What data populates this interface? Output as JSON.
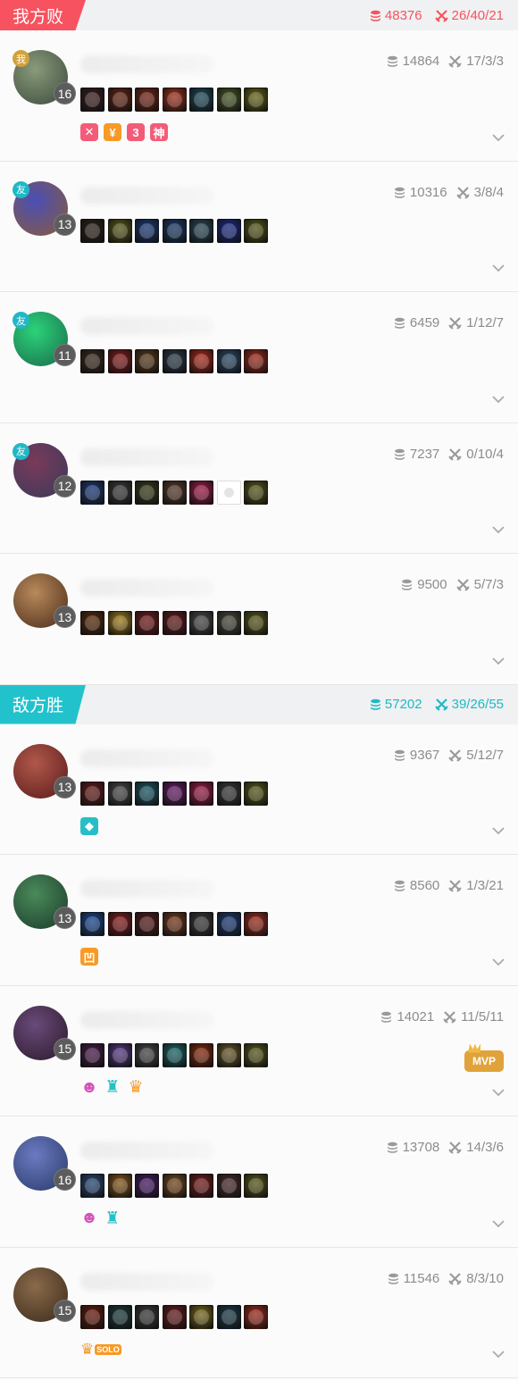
{
  "colors": {
    "lose": "#f7525f",
    "win": "#22c2cc",
    "badge_friend": "#1fb8c6",
    "badge_me": "#d2a23a",
    "badge_orange": "#f79a26",
    "badge_pink": "#f35c78",
    "badge_teal": "#26bfc8",
    "badge_purple": "#d255b9"
  },
  "team_lose": {
    "label": "我方败",
    "gold": "48376",
    "kda": "26/40/21",
    "players": [
      {
        "relation": "我",
        "level": "16",
        "gold": "14864",
        "kda": "17/3/3",
        "avatar": [
          "#3a4a3c",
          "#8a9a7a"
        ],
        "items": [
          "#3b1c1c",
          "#6a2412",
          "#7a2418",
          "#a5321a",
          "#1b4c5a",
          "#4a5a26",
          "#6a6a1a"
        ],
        "badges": [
          {
            "text": "✕",
            "color": "#f35c78"
          },
          {
            "text": "¥",
            "color": "#f79a26"
          },
          {
            "text": "3",
            "color": "#f35c78"
          },
          {
            "text": "神",
            "color": "#f35c78"
          }
        ]
      },
      {
        "relation": "友",
        "level": "13",
        "gold": "10316",
        "kda": "3/8/4",
        "avatar": [
          "#8a5a3a",
          "#4a4fb6"
        ],
        "items": [
          "#2a2016",
          "#5a5a1a",
          "#1a3a7a",
          "#1a3a6a",
          "#2a4a5a",
          "#1a2a8a",
          "#5a5a1a"
        ],
        "badges": []
      },
      {
        "relation": "友",
        "level": "11",
        "gold": "6459",
        "kda": "1/12/7",
        "avatar": [
          "#1a6a4a",
          "#2bd37a"
        ],
        "items": [
          "#3a2a1a",
          "#8a1a1a",
          "#5a3a1a",
          "#2a3a4a",
          "#b32a1a",
          "#2a4a6a",
          "#a52a1a"
        ],
        "badges": []
      },
      {
        "relation": "友",
        "level": "12",
        "gold": "7237",
        "kda": "0/10/4",
        "avatar": [
          "#3a3a5a",
          "#7a3a5a"
        ],
        "items": [
          "#1a3a7a",
          "#3a3a3a",
          "#3a3a1a",
          "#5a3a2a",
          "#a51a4a",
          "empty",
          "#5a5a1a"
        ],
        "badges": []
      },
      {
        "relation": "",
        "level": "13",
        "gold": "9500",
        "kda": "5/7/3",
        "avatar": [
          "#4a2a1a",
          "#b88a5a"
        ],
        "items": [
          "#5a2a0a",
          "#a5801a",
          "#7a1a1a",
          "#6a1a1a",
          "#4a4a4a",
          "#4a4a3a",
          "#5a5a1a"
        ],
        "badges": []
      }
    ]
  },
  "team_win": {
    "label": "敌方胜",
    "gold": "57202",
    "kda": "39/26/55",
    "players": [
      {
        "relation": "",
        "level": "13",
        "gold": "9367",
        "kda": "5/12/7",
        "avatar": [
          "#5a1a1a",
          "#b0584a"
        ],
        "items": [
          "#6a1a1a",
          "#4a4a4a",
          "#1a5a6a",
          "#6a1a6a",
          "#a51a4a",
          "#3a3a3a",
          "#5a5a1a"
        ],
        "badges": [
          {
            "text": "◆",
            "color": "#26bfc8"
          }
        ]
      },
      {
        "relation": "",
        "level": "13",
        "gold": "8560",
        "kda": "1/3/21",
        "avatar": [
          "#1a3a2a",
          "#4a8a5a"
        ],
        "items": [
          "#1a4a9a",
          "#8a1a1a",
          "#5a1a1a",
          "#7a3a1a",
          "#3a3a3a",
          "#1a3a7a",
          "#a52a1a"
        ],
        "badges": [
          {
            "text": "凹",
            "color": "#f79a26"
          }
        ]
      },
      {
        "relation": "",
        "level": "15",
        "gold": "14021",
        "kda": "11/5/11",
        "avatar": [
          "#2a1a2a",
          "#6a4a7a"
        ],
        "items": [
          "#4a1a4a",
          "#5a3a8a",
          "#4a4a4a",
          "#1a6a6a",
          "#8a2a0a",
          "#6a5a2a",
          "#5a5a1a"
        ],
        "badges": [
          {
            "text": "☻",
            "color": "#d255b9",
            "sym": true
          },
          {
            "text": "♜",
            "color": "#26bfc8",
            "sym": true
          },
          {
            "text": "♛",
            "color": "#f79a26",
            "sym": true
          }
        ],
        "mvp": "MVP"
      },
      {
        "relation": "",
        "level": "16",
        "gold": "13708",
        "kda": "14/3/6",
        "avatar": [
          "#2a3a6a",
          "#6a7ac0"
        ],
        "items": [
          "#2a4a7a",
          "#8a5a1a",
          "#4a1a6a",
          "#7a4a1a",
          "#7a1a1a",
          "#4a2a2a",
          "#5a5a1a"
        ],
        "badges": [
          {
            "text": "☻",
            "color": "#d255b9",
            "sym": true
          },
          {
            "text": "♜",
            "color": "#26bfc8",
            "sym": true
          }
        ]
      },
      {
        "relation": "",
        "level": "15",
        "gold": "11546",
        "kda": "8/3/10",
        "avatar": [
          "#3a2a1a",
          "#8a6a4a"
        ],
        "items": [
          "#6a1a0a",
          "#1a3a3a",
          "#3a3a3a",
          "#6a1a1a",
          "#7a6a1a",
          "#1a3a4a",
          "#a52a1a"
        ],
        "badges": [
          {
            "text": "SOLO",
            "color": "#f79a26",
            "solo": true
          }
        ]
      }
    ]
  }
}
